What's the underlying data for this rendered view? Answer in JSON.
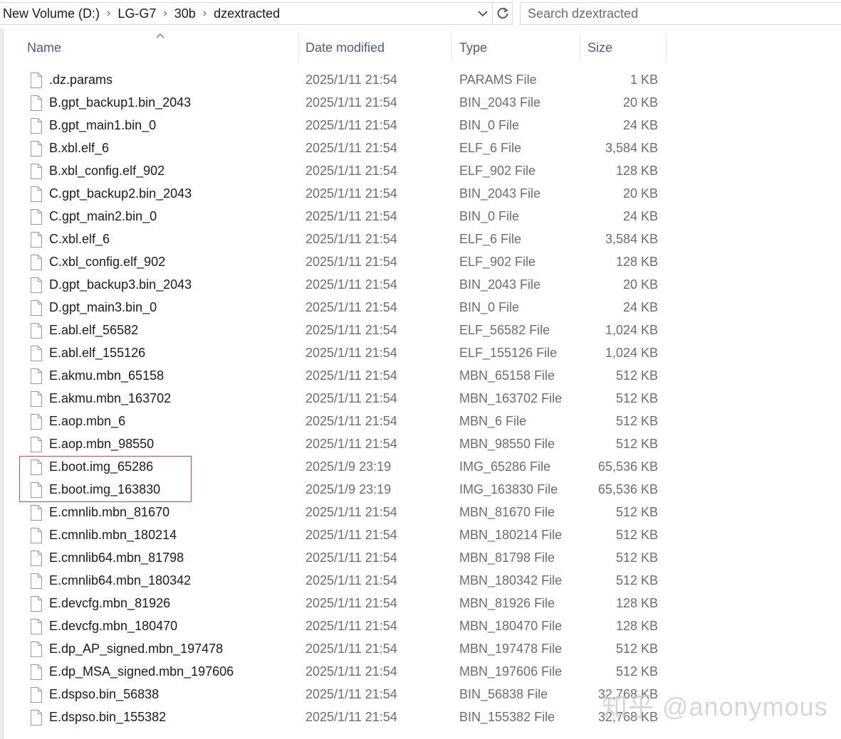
{
  "address_bar": {
    "breadcrumbs": [
      "New Volume (D:)",
      "LG-G7",
      "30b",
      "dzextracted"
    ],
    "dropdown_icon": "chevron-down-icon",
    "refresh_icon": "refresh-icon"
  },
  "search": {
    "placeholder": "Search dzextracted"
  },
  "columns": {
    "name": "Name",
    "date": "Date modified",
    "type": "Type",
    "size": "Size"
  },
  "files": [
    {
      "name": ".dz.params",
      "date": "2025/1/11 21:54",
      "type": "PARAMS File",
      "size": "1 KB"
    },
    {
      "name": "B.gpt_backup1.bin_2043",
      "date": "2025/1/11 21:54",
      "type": "BIN_2043 File",
      "size": "20 KB"
    },
    {
      "name": "B.gpt_main1.bin_0",
      "date": "2025/1/11 21:54",
      "type": "BIN_0 File",
      "size": "24 KB"
    },
    {
      "name": "B.xbl.elf_6",
      "date": "2025/1/11 21:54",
      "type": "ELF_6 File",
      "size": "3,584 KB"
    },
    {
      "name": "B.xbl_config.elf_902",
      "date": "2025/1/11 21:54",
      "type": "ELF_902 File",
      "size": "128 KB"
    },
    {
      "name": "C.gpt_backup2.bin_2043",
      "date": "2025/1/11 21:54",
      "type": "BIN_2043 File",
      "size": "20 KB"
    },
    {
      "name": "C.gpt_main2.bin_0",
      "date": "2025/1/11 21:54",
      "type": "BIN_0 File",
      "size": "24 KB"
    },
    {
      "name": "C.xbl.elf_6",
      "date": "2025/1/11 21:54",
      "type": "ELF_6 File",
      "size": "3,584 KB"
    },
    {
      "name": "C.xbl_config.elf_902",
      "date": "2025/1/11 21:54",
      "type": "ELF_902 File",
      "size": "128 KB"
    },
    {
      "name": "D.gpt_backup3.bin_2043",
      "date": "2025/1/11 21:54",
      "type": "BIN_2043 File",
      "size": "20 KB"
    },
    {
      "name": "D.gpt_main3.bin_0",
      "date": "2025/1/11 21:54",
      "type": "BIN_0 File",
      "size": "24 KB"
    },
    {
      "name": "E.abl.elf_56582",
      "date": "2025/1/11 21:54",
      "type": "ELF_56582 File",
      "size": "1,024 KB"
    },
    {
      "name": "E.abl.elf_155126",
      "date": "2025/1/11 21:54",
      "type": "ELF_155126 File",
      "size": "1,024 KB"
    },
    {
      "name": "E.akmu.mbn_65158",
      "date": "2025/1/11 21:54",
      "type": "MBN_65158 File",
      "size": "512 KB"
    },
    {
      "name": "E.akmu.mbn_163702",
      "date": "2025/1/11 21:54",
      "type": "MBN_163702 File",
      "size": "512 KB"
    },
    {
      "name": "E.aop.mbn_6",
      "date": "2025/1/11 21:54",
      "type": "MBN_6 File",
      "size": "512 KB"
    },
    {
      "name": "E.aop.mbn_98550",
      "date": "2025/1/11 21:54",
      "type": "MBN_98550 File",
      "size": "512 KB"
    },
    {
      "name": "E.boot.img_65286",
      "date": "2025/1/9 23:19",
      "type": "IMG_65286 File",
      "size": "65,536 KB"
    },
    {
      "name": "E.boot.img_163830",
      "date": "2025/1/9 23:19",
      "type": "IMG_163830 File",
      "size": "65,536 KB"
    },
    {
      "name": "E.cmnlib.mbn_81670",
      "date": "2025/1/11 21:54",
      "type": "MBN_81670 File",
      "size": "512 KB"
    },
    {
      "name": "E.cmnlib.mbn_180214",
      "date": "2025/1/11 21:54",
      "type": "MBN_180214 File",
      "size": "512 KB"
    },
    {
      "name": "E.cmnlib64.mbn_81798",
      "date": "2025/1/11 21:54",
      "type": "MBN_81798 File",
      "size": "512 KB"
    },
    {
      "name": "E.cmnlib64.mbn_180342",
      "date": "2025/1/11 21:54",
      "type": "MBN_180342 File",
      "size": "512 KB"
    },
    {
      "name": "E.devcfg.mbn_81926",
      "date": "2025/1/11 21:54",
      "type": "MBN_81926 File",
      "size": "128 KB"
    },
    {
      "name": "E.devcfg.mbn_180470",
      "date": "2025/1/11 21:54",
      "type": "MBN_180470 File",
      "size": "128 KB"
    },
    {
      "name": "E.dp_AP_signed.mbn_197478",
      "date": "2025/1/11 21:54",
      "type": "MBN_197478 File",
      "size": "512 KB"
    },
    {
      "name": "E.dp_MSA_signed.mbn_197606",
      "date": "2025/1/11 21:54",
      "type": "MBN_197606 File",
      "size": "512 KB"
    },
    {
      "name": "E.dspso.bin_56838",
      "date": "2025/1/11 21:54",
      "type": "BIN_56838 File",
      "size": "32,768 KB"
    },
    {
      "name": "E.dspso.bin_155382",
      "date": "2025/1/11 21:54",
      "type": "BIN_155382 File",
      "size": "32,768 KB"
    }
  ],
  "watermark": "知乎 @anonymous",
  "colors": {
    "highlight_border": "#d9474a",
    "header_text": "#4c607a",
    "secondary_text": "#6d6d6d"
  }
}
